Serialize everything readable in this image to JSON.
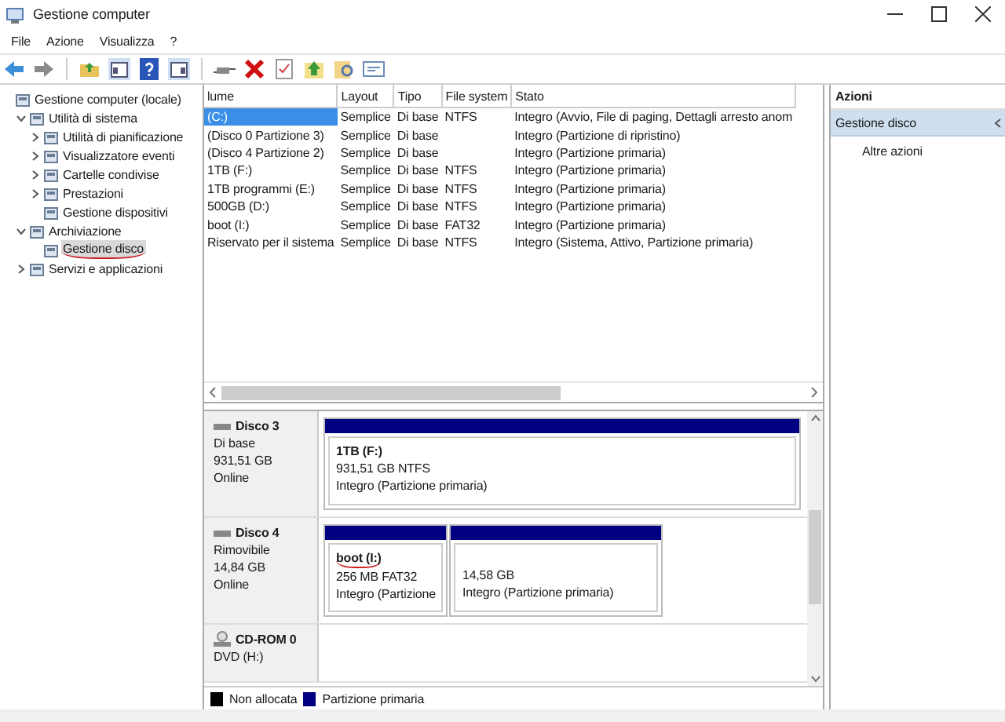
{
  "window": {
    "title": "Gestione computer"
  },
  "menu": [
    "File",
    "Azione",
    "Visualizza",
    "?"
  ],
  "tree": [
    {
      "label": "Gestione computer (locale)",
      "selected": false,
      "underlined": false,
      "children": [
        {
          "label": "Utilità di sistema",
          "expanded": true,
          "selected": false,
          "underlined": false,
          "children": [
            {
              "label": "Utilità di pianificazione",
              "expanded": false,
              "selected": false,
              "underlined": false
            },
            {
              "label": "Visualizzatore eventi",
              "expanded": false,
              "selected": false,
              "underlined": false
            },
            {
              "label": "Cartelle condivise",
              "expanded": false,
              "selected": false,
              "underlined": false
            },
            {
              "label": "Prestazioni",
              "expanded": false,
              "selected": false,
              "underlined": false
            },
            {
              "label": "Gestione dispositivi",
              "selected": false,
              "underlined": false
            }
          ]
        },
        {
          "label": "Archiviazione",
          "expanded": true,
          "selected": false,
          "underlined": false,
          "children": [
            {
              "label": "Gestione disco",
              "selected": true,
              "underlined": true
            }
          ]
        },
        {
          "label": "Servizi e applicazioni",
          "expanded": false,
          "selected": false,
          "underlined": false
        }
      ]
    }
  ],
  "table": {
    "columns": [
      "lume",
      "Layout",
      "Tipo",
      "File system",
      "Stato"
    ],
    "rows": [
      {
        "cells": [
          "(C:)",
          "Semplice",
          "Di base",
          "NTFS",
          "Integro (Avvio, File di paging, Dettagli arresto anom"
        ],
        "selected": true
      },
      {
        "cells": [
          "(Disco 0 Partizione 3)",
          "Semplice",
          "Di base",
          "",
          "Integro (Partizione di ripristino)"
        ],
        "selected": false
      },
      {
        "cells": [
          "(Disco 4 Partizione 2)",
          "Semplice",
          "Di base",
          "",
          "Integro (Partizione primaria)"
        ],
        "selected": false
      },
      {
        "cells": [
          "1TB (F:)",
          "Semplice",
          "Di base",
          "NTFS",
          "Integro (Partizione primaria)"
        ],
        "selected": false
      },
      {
        "cells": [
          "1TB programmi (E:)",
          "Semplice",
          "Di base",
          "NTFS",
          "Integro (Partizione primaria)"
        ],
        "selected": false
      },
      {
        "cells": [
          "500GB (D:)",
          "Semplice",
          "Di base",
          "NTFS",
          "Integro (Partizione primaria)"
        ],
        "selected": false
      },
      {
        "cells": [
          "boot (I:)",
          "Semplice",
          "Di base",
          "FAT32",
          "Integro (Partizione primaria)"
        ],
        "selected": false
      },
      {
        "cells": [
          "Riservato per il sistema",
          "Semplice",
          "Di base",
          "NTFS",
          "Integro (Sistema, Attivo, Partizione primaria)"
        ],
        "selected": false
      }
    ]
  },
  "disks": [
    {
      "name": "Disco 3",
      "kind": "disk",
      "lines": [
        "Di base",
        "931,51 GB",
        "Online"
      ],
      "partitions": [
        {
          "title": "1TB  (F:)",
          "lines": [
            "931,51 GB NTFS",
            "Integro (Partizione primaria)"
          ],
          "underlined": false
        }
      ]
    },
    {
      "name": "Disco 4",
      "kind": "disk",
      "lines": [
        "Rimovibile",
        "14,84 GB",
        "Online"
      ],
      "partitions": [
        {
          "title": "boot  (I:)",
          "lines": [
            "256 MB FAT32",
            "Integro (Partizione"
          ],
          "underlined": true
        },
        {
          "lines": [
            "14,58 GB",
            "Integro (Partizione primaria)"
          ],
          "underlined": false
        }
      ]
    },
    {
      "name": "CD-ROM 0",
      "kind": "optical",
      "lines": [
        "DVD (H:)"
      ]
    }
  ],
  "legend": [
    {
      "label": "Non allocata",
      "color": "#000000"
    },
    {
      "label": "Partizione primaria",
      "color": "#000080"
    }
  ],
  "actions": {
    "title": "Azioni",
    "items": [
      {
        "label": "Gestione disco",
        "kind": "section"
      },
      {
        "label": "Altre azioni",
        "kind": "link"
      }
    ]
  }
}
